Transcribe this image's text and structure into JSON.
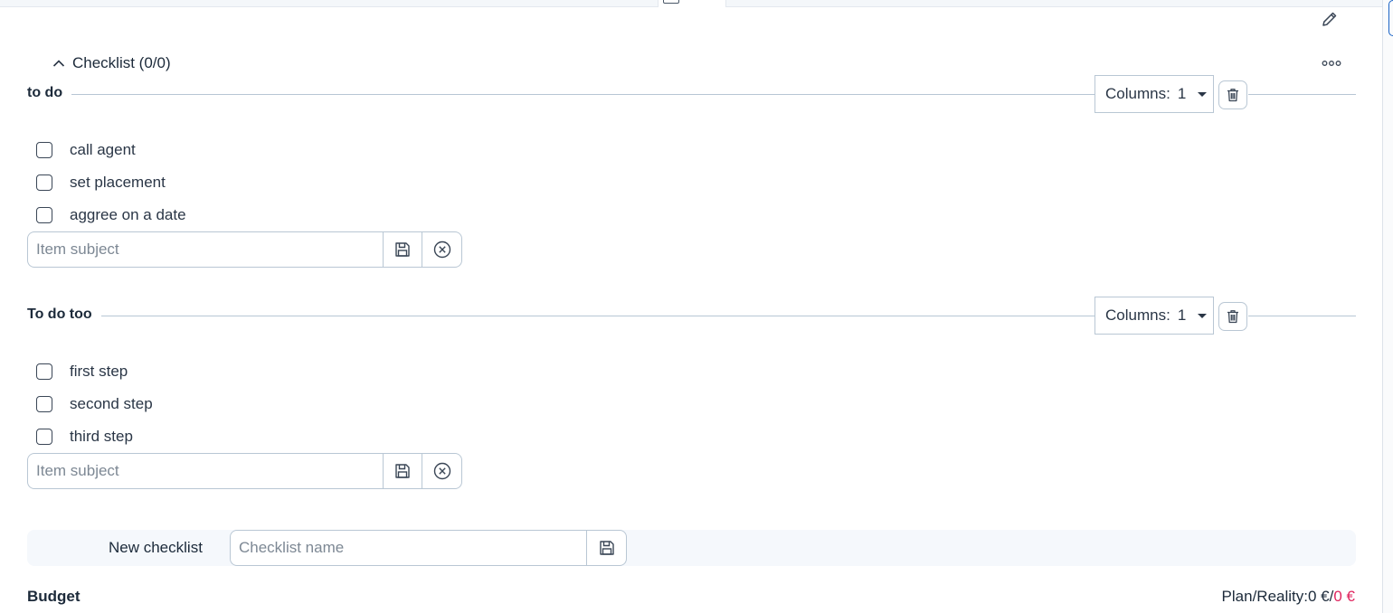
{
  "checklist_section": {
    "title": "Checklist (0/0)"
  },
  "groups": [
    {
      "title": "to do",
      "columns_label": "Columns:",
      "columns_value": "1",
      "items": [
        "call agent",
        "set placement",
        "aggree on a date"
      ],
      "input_placeholder": "Item subject"
    },
    {
      "title": "To do too",
      "columns_label": "Columns:",
      "columns_value": "1",
      "items": [
        "first step",
        "second step",
        "third step"
      ],
      "input_placeholder": "Item subject"
    }
  ],
  "new_checklist": {
    "label": "New checklist",
    "placeholder": "Checklist name"
  },
  "budget": {
    "title": "Budget",
    "plan_label": "Plan/Reality:",
    "plan_value": "0 €",
    "separator": "/",
    "reality_value": "0 €"
  },
  "colors": {
    "accent_blue": "#1a63c6",
    "reality_red": "#e0245e",
    "border": "#b9c7d4"
  },
  "icons": [
    "pencil-icon",
    "more-horizontal-icon",
    "chevron-up-icon",
    "trash-icon",
    "save-icon",
    "close-circle-icon"
  ]
}
